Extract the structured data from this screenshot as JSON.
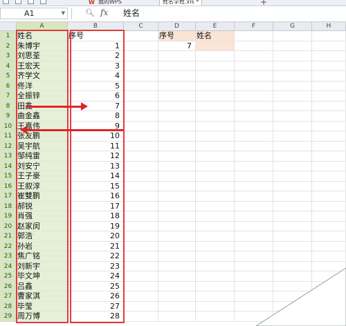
{
  "toolbar": {
    "doc_tab_1": "我的WPS",
    "doc_tab_2": "姓名学姓.xls *",
    "plus": "+"
  },
  "formula_bar": {
    "name_box": "A1",
    "fx": "fx",
    "content": "姓名"
  },
  "columns": [
    "A",
    "B",
    "C",
    "D",
    "E",
    "F",
    "G",
    "H"
  ],
  "rows": [
    {
      "n": "1",
      "a": "姓名",
      "b": "序号"
    },
    {
      "n": "2",
      "a": "朱博宇",
      "b": "1"
    },
    {
      "n": "3",
      "a": "刘思荃",
      "b": "2"
    },
    {
      "n": "4",
      "a": "王宏天",
      "b": "3"
    },
    {
      "n": "5",
      "a": "齐学文",
      "b": "4"
    },
    {
      "n": "6",
      "a": "佟洋",
      "b": "5"
    },
    {
      "n": "7",
      "a": "全振锌",
      "b": "6"
    },
    {
      "n": "8",
      "a": "田鑫",
      "b": "7"
    },
    {
      "n": "9",
      "a": "曲金鑫",
      "b": "8"
    },
    {
      "n": "10",
      "a": "王嘉伟",
      "b": "9"
    },
    {
      "n": "11",
      "a": "张友鹏",
      "b": "10"
    },
    {
      "n": "12",
      "a": "吴宇航",
      "b": "11"
    },
    {
      "n": "13",
      "a": "邹纯雷",
      "b": "12"
    },
    {
      "n": "14",
      "a": "刘安宁",
      "b": "13"
    },
    {
      "n": "15",
      "a": "王子豪",
      "b": "14"
    },
    {
      "n": "16",
      "a": "王叙淳",
      "b": "15"
    },
    {
      "n": "17",
      "a": "崔雙鹏",
      "b": "16"
    },
    {
      "n": "18",
      "a": "郝锐",
      "b": "17"
    },
    {
      "n": "19",
      "a": "肖强",
      "b": "18"
    },
    {
      "n": "20",
      "a": "赵家闵",
      "b": "19"
    },
    {
      "n": "21",
      "a": "郭浩",
      "b": "20"
    },
    {
      "n": "22",
      "a": "孙岩",
      "b": "21"
    },
    {
      "n": "23",
      "a": "焦广铭",
      "b": "22"
    },
    {
      "n": "24",
      "a": "刘新宇",
      "b": "23"
    },
    {
      "n": "25",
      "a": "毕文坤",
      "b": "24"
    },
    {
      "n": "26",
      "a": "吕鑫",
      "b": "25"
    },
    {
      "n": "27",
      "a": "曹家淇",
      "b": "26"
    },
    {
      "n": "28",
      "a": "毕莹",
      "b": "27"
    },
    {
      "n": "29",
      "a": "周万博",
      "b": "28"
    }
  ],
  "lookup": {
    "d1": "序号",
    "e1": "姓名",
    "d2": "7",
    "e2": ""
  },
  "colors": {
    "selected_column": "#e6f0d7",
    "header_fill": "#fbe4d5",
    "annotation_red": "#e23b3b"
  }
}
